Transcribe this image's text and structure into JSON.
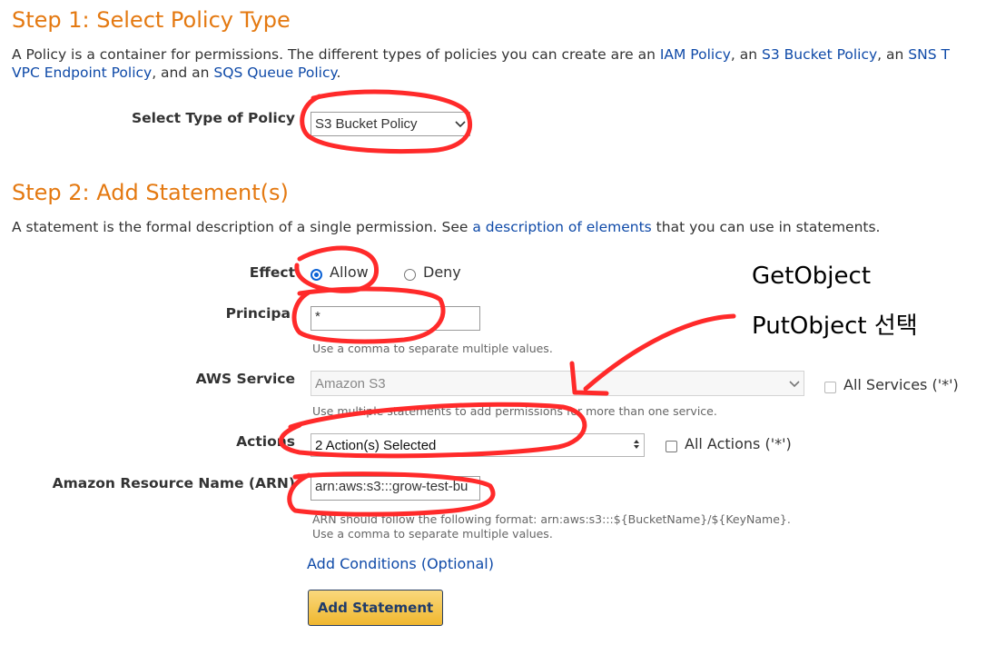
{
  "step1": {
    "title": "Step 1: Select Policy Type",
    "intro_prefix": "A Policy is a container for permissions. The different types of policies you can create are an ",
    "link_iam": "IAM Policy",
    "sep1": ", an ",
    "link_s3": "S3 Bucket Policy",
    "sep2": ", an ",
    "link_sns": "SNS T",
    "link_vpc": "VPC Endpoint Policy",
    "sep3": ", and an ",
    "link_sqs": "SQS Queue Policy",
    "sep4": ".",
    "policy_type_label": "Select Type of Policy",
    "policy_type_value": "S3 Bucket Policy"
  },
  "step2": {
    "title": "Step 2: Add Statement(s)",
    "intro_prefix": "A statement is the formal description of a single permission. See ",
    "intro_link": "a description of elements",
    "intro_suffix": " that you can use in statements.",
    "effect_label": "Effect",
    "effect_allow": "Allow",
    "effect_deny": "Deny",
    "effect_selected": "Allow",
    "principal_label": "Principa",
    "principal_value": "*",
    "principal_hint": "Use a comma to separate multiple values.",
    "service_label": "AWS Service",
    "service_value": "Amazon S3",
    "all_services_label": "All Services ('*')",
    "service_hint": "Use multiple statements to add permissions for more than one service.",
    "actions_label": "Actions",
    "actions_value": "2 Action(s) Selected",
    "all_actions_label": "All Actions ('*')",
    "arn_label": "Amazon Resource Name (ARN)",
    "arn_value": "arn:aws:s3:::grow-test-bu",
    "arn_hint_1": "ARN should follow the following format: arn:aws:s3:::${BucketName}/${KeyName}.",
    "arn_hint_2": "Use a comma to separate multiple values.",
    "add_conditions": "Add Conditions (Optional)",
    "add_statement": "Add Statement"
  },
  "annotation": {
    "line1": "GetObject",
    "line2": "PutObject 선택",
    "color": "#ff2a2a"
  },
  "colors": {
    "heading": "#e47911",
    "link": "#0f4aa8",
    "radio_selected": "#0b62d6",
    "button_fill": "#f0b72f"
  },
  "icons": {
    "select_arrow": "chevron-down-icon",
    "actions_arrow": "up-down-arrows-icon"
  }
}
